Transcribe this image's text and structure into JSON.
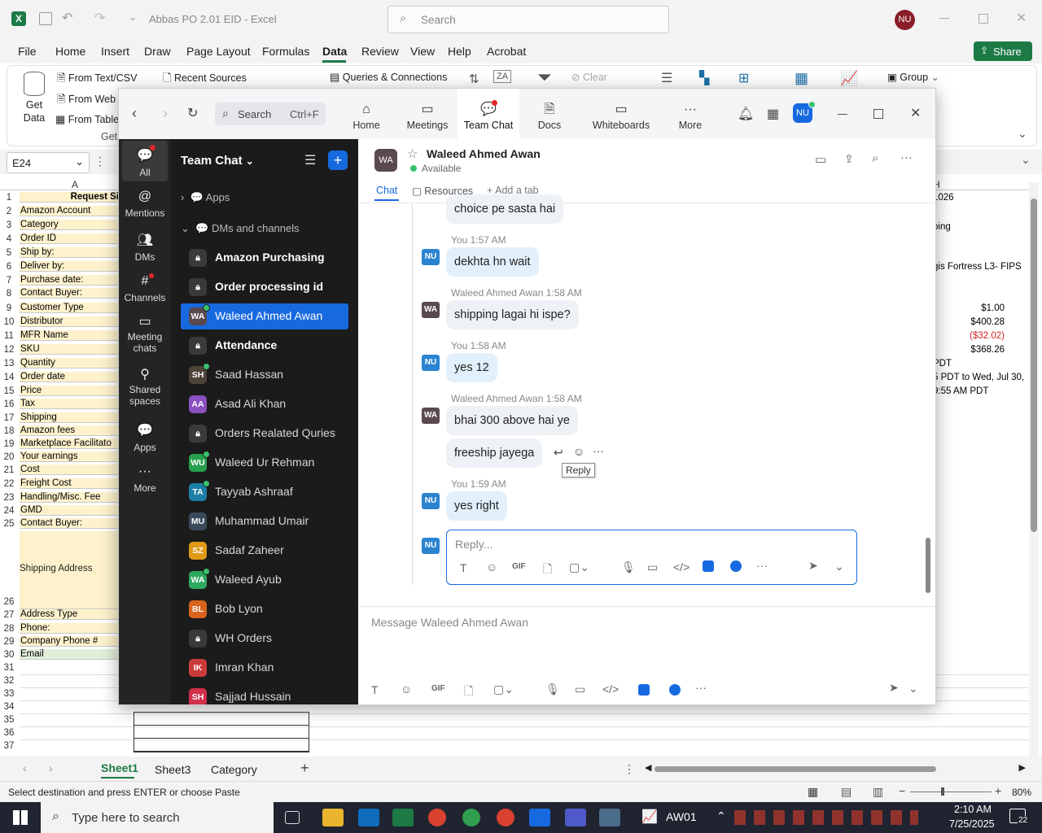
{
  "excel": {
    "title": "Abbas PO 2.01 EID  -  Excel",
    "search_placeholder": "Search",
    "user_initials": "NU",
    "share_label": "Share",
    "menu": [
      "File",
      "Home",
      "Insert",
      "Draw",
      "Page Layout",
      "Formulas",
      "Data",
      "Review",
      "View",
      "Help",
      "Acrobat"
    ],
    "active_menu": "Data",
    "ribbon": {
      "get_data": "Get Data",
      "from_text": "From Text/CSV",
      "from_web": "From Web",
      "from_table": "From Table",
      "get_label": "Get",
      "recent_sources": "Recent Sources",
      "queries": "Queries & Connections",
      "clear": "Clear",
      "group": "Group"
    },
    "name_box": "E24",
    "column_a_header": "A",
    "column_h_header": "H",
    "a1_partial": "Request Si",
    "rows": [
      {
        "num": "1",
        "label": "Request Si"
      },
      {
        "num": "2",
        "label": "Amazon Account"
      },
      {
        "num": "3",
        "label": "Category"
      },
      {
        "num": "4",
        "label": "Order ID"
      },
      {
        "num": "5",
        "label": "Ship by:"
      },
      {
        "num": "6",
        "label": "Deliver by:"
      },
      {
        "num": "7",
        "label": "Purchase date:"
      },
      {
        "num": "8",
        "label": "Contact Buyer:"
      },
      {
        "num": "9",
        "label": "Customer Type"
      },
      {
        "num": "10",
        "label": "Distributor"
      },
      {
        "num": "11",
        "label": "MFR Name"
      },
      {
        "num": "12",
        "label": "SKU"
      },
      {
        "num": "13",
        "label": "Quantity"
      },
      {
        "num": "14",
        "label": "Order date"
      },
      {
        "num": "15",
        "label": "Price"
      },
      {
        "num": "16",
        "label": "Tax"
      },
      {
        "num": "17",
        "label": "Shipping"
      },
      {
        "num": "18",
        "label": "Amazon fees"
      },
      {
        "num": "19",
        "label": "Marketplace Facilitato"
      },
      {
        "num": "20",
        "label": "Your earnings"
      },
      {
        "num": "21",
        "label": "Cost"
      },
      {
        "num": "22",
        "label": "Freight Cost"
      },
      {
        "num": "23",
        "label": "Handling/Misc. Fee"
      },
      {
        "num": "24",
        "label": "GMD"
      },
      {
        "num": "25",
        "label": "Contact Buyer:"
      }
    ],
    "shipping_address": "Shipping Address",
    "rows_after": [
      {
        "num": "26",
        "label": ""
      },
      {
        "num": "27",
        "label": "Address Type"
      },
      {
        "num": "28",
        "label": "Phone:"
      },
      {
        "num": "29",
        "label": "Company Phone #"
      },
      {
        "num": "30",
        "label": "Email"
      },
      {
        "num": "31",
        "label": ""
      },
      {
        "num": "32",
        "label": ""
      },
      {
        "num": "33",
        "label": ""
      },
      {
        "num": "34",
        "label": ""
      },
      {
        "num": "35",
        "label": ""
      },
      {
        "num": "36",
        "label": ""
      },
      {
        "num": "37",
        "label": ""
      }
    ],
    "right_cells": {
      "r1": "1026",
      "r3": "ping",
      "r6": "gis Fortress L3- FIPS",
      "r9": "$1.00",
      "r10": "$400.28",
      "r11": "($32.02)",
      "r12": "$368.26",
      "r13": "PDT",
      "r14": "5 PDT to Wed, Jul 30,",
      "r15": "9:55 AM PDT"
    },
    "sheet_tabs": [
      "Sheet1",
      "Sheet3",
      "Category"
    ],
    "active_sheet": "Sheet1",
    "status_text": "Select destination and press ENTER or choose Paste",
    "zoom": "80%"
  },
  "zoom_app": {
    "search_label": "Search",
    "search_shortcut": "Ctrl+F",
    "tabs": [
      "Home",
      "Meetings",
      "Team Chat",
      "Docs",
      "Whiteboards",
      "More"
    ],
    "active_tab": "Team Chat",
    "user_initials": "NU",
    "rail": [
      "All",
      "Mentions",
      "DMs",
      "Channels",
      "Meeting chats",
      "Shared spaces",
      "Apps",
      "More"
    ],
    "list_header": "Team Chat",
    "section_apps": "Apps",
    "section_dms": "DMs and channels",
    "channels": [
      {
        "name": "Amazon Purchasing",
        "kind": "lock",
        "bold": true
      },
      {
        "name": "Order processing id",
        "kind": "lock",
        "bold": true
      },
      {
        "name": "Waleed Ahmed Awan",
        "kind": "photo",
        "selected": true
      },
      {
        "name": "Attendance",
        "kind": "lock",
        "bold": true
      },
      {
        "name": "Saad Hassan",
        "kind": "photo2"
      },
      {
        "name": "Asad Ali Khan",
        "initials": "AA",
        "color": "#8a4fc0"
      },
      {
        "name": "Orders Realated Quries",
        "kind": "lock"
      },
      {
        "name": "Waleed Ur Rehman",
        "initials": "WU",
        "color": "#27a04e"
      },
      {
        "name": "Tayyab Ashraaf",
        "initials": "TA",
        "color": "#1c7fa6"
      },
      {
        "name": "Muhammad Umair",
        "initials": "MU",
        "color": "#3a4a5c"
      },
      {
        "name": "Sadaf Zaheer",
        "initials": "SZ",
        "color": "#e09a18"
      },
      {
        "name": "Waleed Ayub",
        "initials": "WA",
        "color": "#2fa860"
      },
      {
        "name": "Bob Lyon",
        "initials": "BL",
        "color": "#d9631c"
      },
      {
        "name": "WH Orders",
        "kind": "lock"
      },
      {
        "name": "Imran Khan",
        "initials": "IK",
        "color": "#cc3b3b"
      },
      {
        "name": "Sajjad Hussain",
        "initials": "SH",
        "color": "#d12f4a"
      }
    ],
    "contact": {
      "name": "Waleed Ahmed Awan",
      "status": "Available"
    },
    "chat_tabs": [
      "Chat",
      "Resources",
      "Add a tab"
    ],
    "messages": [
      {
        "who": "them",
        "meta": "",
        "text": "choice pe sasta hai"
      },
      {
        "who": "me",
        "meta": "You 1:57 AM",
        "text": "dekhta hn wait"
      },
      {
        "who": "them",
        "meta": "Waleed Ahmed Awan 1:58 AM",
        "text": "shipping lagai hi ispe?"
      },
      {
        "who": "me",
        "meta": "You 1:58 AM",
        "text": "yes 12"
      },
      {
        "who": "them",
        "meta": "Waleed Ahmed Awan 1:58 AM",
        "text": "bhai 300 above hai ye"
      },
      {
        "who": "them",
        "meta": "",
        "text": "freeship jayega"
      },
      {
        "who": "me",
        "meta": "You 1:59 AM",
        "text": "yes right"
      }
    ],
    "reply_tooltip": "Reply",
    "reply_placeholder": "Reply...",
    "message_placeholder": "Message Waleed Ahmed Awan"
  },
  "taskbar": {
    "search_placeholder": "Type here to search",
    "ticker": "AW01",
    "time": "2:10 AM",
    "date": "7/25/2025",
    "notif_count": "22"
  }
}
